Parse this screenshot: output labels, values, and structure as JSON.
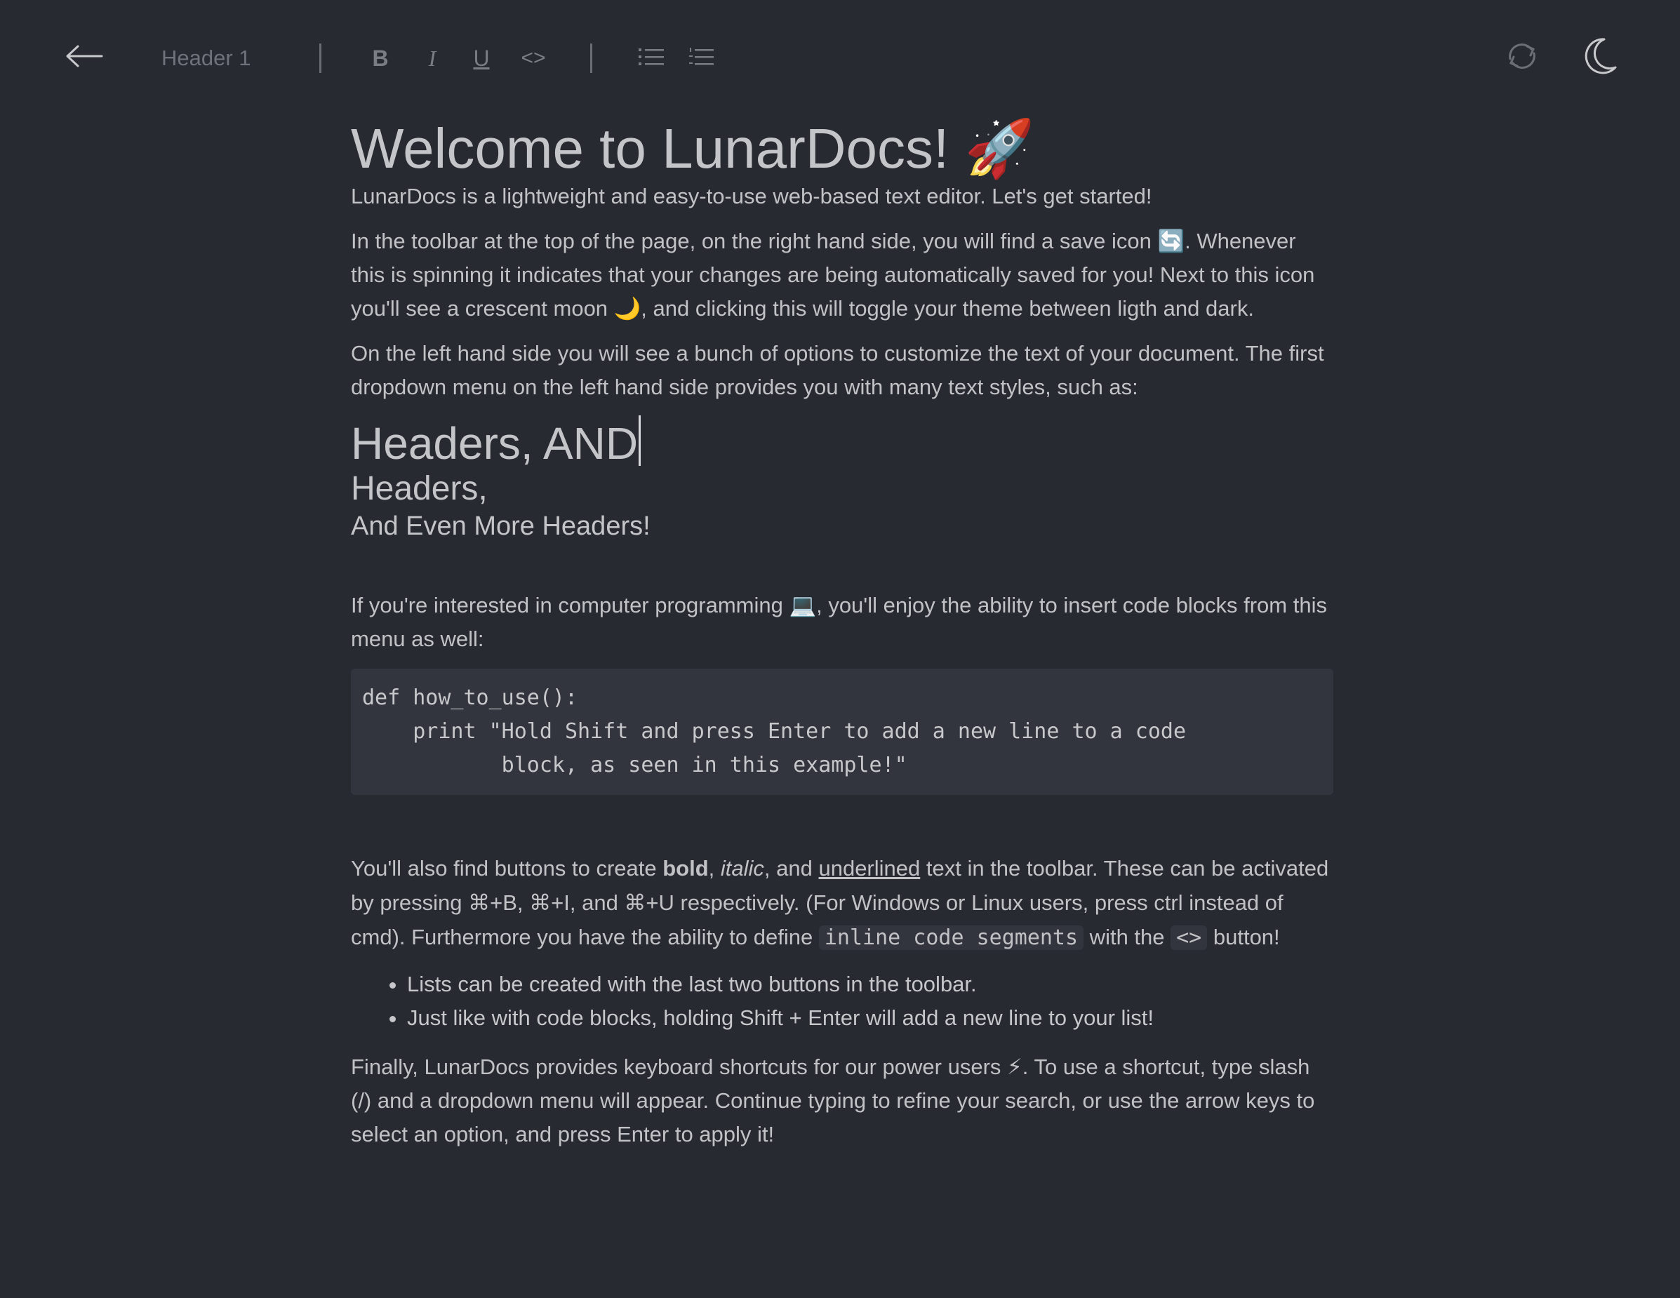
{
  "toolbar": {
    "back_icon": "arrow-left-icon",
    "style_select": "Header 1",
    "bold": "B",
    "italic": "I",
    "underline": "U",
    "code": "<>",
    "ul_icon": "bulleted-list-icon",
    "ol_icon": "numbered-list-icon",
    "save_icon": "sync-icon",
    "theme_icon": "moon-icon"
  },
  "doc": {
    "title": "Welcome to LunarDocs! ",
    "title_emoji": "🚀",
    "intro": "LunarDocs is a lightweight and easy-to-use web-based text editor.  Let's get started!",
    "p_toolbar_a": "In the toolbar at the top of the page, on the right hand side, you will find a save icon ",
    "p_toolbar_emoji1": "🔄",
    "p_toolbar_b": ". Whenever this is spinning it indicates that your changes are being automatically saved for you! Next to this icon you'll see a crescent moon ",
    "p_toolbar_emoji2": "🌙",
    "p_toolbar_c": ", and clicking this will toggle your theme between ligth and dark.",
    "p_options": "On the left hand side you will see a bunch of options to customize the text of your document. The first dropdown menu on the left hand side provides you with many text styles, such as:",
    "h1": "Headers, AND",
    "h2": "Headers,",
    "h3": "And Even More Headers!",
    "p_code_a": "If you're interested in computer programming ",
    "p_code_emoji": "💻",
    "p_code_b": ", you'll enjoy the ability to insert code blocks from this menu as well:",
    "code_block": "def how_to_use():\n    print \"Hold Shift and press Enter to add a new line to a code\n           block, as seen in this example!\"",
    "p_fmt_a": "You'll also find buttons to create ",
    "p_fmt_bold": "bold",
    "p_fmt_b": ", ",
    "p_fmt_italic": "italic",
    "p_fmt_c": ", and ",
    "p_fmt_underline": "underlined",
    "p_fmt_d": " text in the toolbar. These can be activated by pressing ⌘+B, ⌘+I, and ⌘+U respectively. (For Windows or Linux users, press ctrl instead of cmd). Furthermore you have the ability to define ",
    "p_fmt_inline": "inline code segments",
    "p_fmt_e": " with the ",
    "p_fmt_inline2": "<>",
    "p_fmt_f": " button!",
    "list": [
      "Lists can be created with the last two buttons in the toolbar.",
      "Just like with code blocks, holding Shift + Enter will add a new line to your list!"
    ],
    "p_final_a": "Finally, LunarDocs provides keyboard shortcuts for our power users ",
    "p_final_emoji": "⚡",
    "p_final_b": ". To use a shortcut, type slash (/) and a dropdown menu will appear. Continue typing to refine your search, or use the arrow keys to select an option, and press Enter to apply it!"
  }
}
